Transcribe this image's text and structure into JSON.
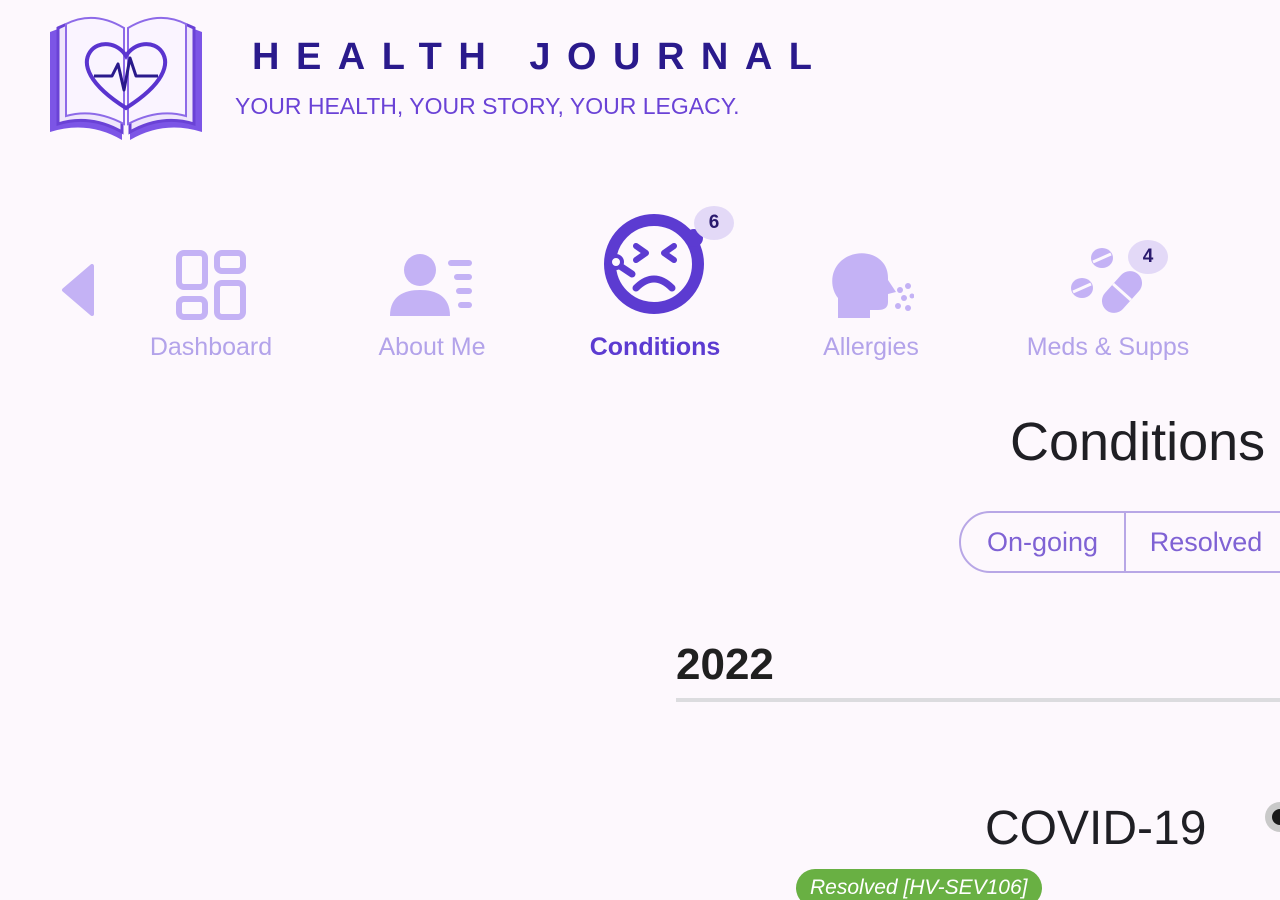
{
  "header": {
    "title": "HEALTH JOURNAL",
    "tagline": "YOUR HEALTH, YOUR STORY, YOUR LEGACY.",
    "logo_icon": "heart-book-icon"
  },
  "nav": {
    "prev_icon": "chevron-left-icon",
    "items": [
      {
        "label": "Dashboard",
        "icon": "dashboard-grid-icon",
        "active": false
      },
      {
        "label": "About Me",
        "icon": "person-list-icon",
        "active": false
      },
      {
        "label": "Conditions",
        "icon": "sick-face-icon",
        "active": true,
        "badge": "6"
      },
      {
        "label": "Allergies",
        "icon": "sneeze-head-icon",
        "active": false
      },
      {
        "label": "Meds & Supps",
        "icon": "pills-icon",
        "active": false,
        "badge": "4"
      }
    ]
  },
  "main": {
    "title": "Conditions",
    "filters": {
      "options": [
        "On-going",
        "Resolved"
      ]
    },
    "groups": [
      {
        "year": "2022",
        "conditions": [
          {
            "name": "COVID-19",
            "status": "Resolved [HV-SEV106]"
          }
        ]
      }
    ]
  },
  "colors": {
    "background": "#fdf8fd",
    "brand_dark": "#2a1a8c",
    "accent": "#5c3bd1",
    "nav_inactive": "#b3a3ea",
    "status_resolved": "#69b043"
  }
}
